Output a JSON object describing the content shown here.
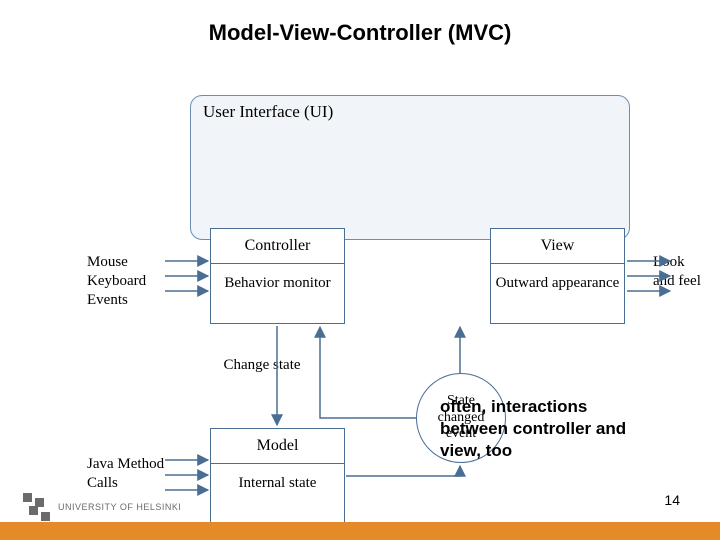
{
  "title": "Model-View-Controller (MVC)",
  "ui_label": "User Interface (UI)",
  "boxes": {
    "controller": {
      "title": "Controller",
      "sub": "Behavior monitor"
    },
    "view": {
      "title": "View",
      "sub": "Outward appearance"
    },
    "model": {
      "title": "Model",
      "sub": "Internal state"
    }
  },
  "circle": "State changed event",
  "ext": {
    "inputs": "Mouse Keyboard Events",
    "java": "Java Method Calls",
    "look": "Look and feel"
  },
  "change_label": "Change state",
  "note": "often, interactions between controller and view, too",
  "page_number": "14",
  "footer": {
    "university": "University of Helsinki"
  }
}
